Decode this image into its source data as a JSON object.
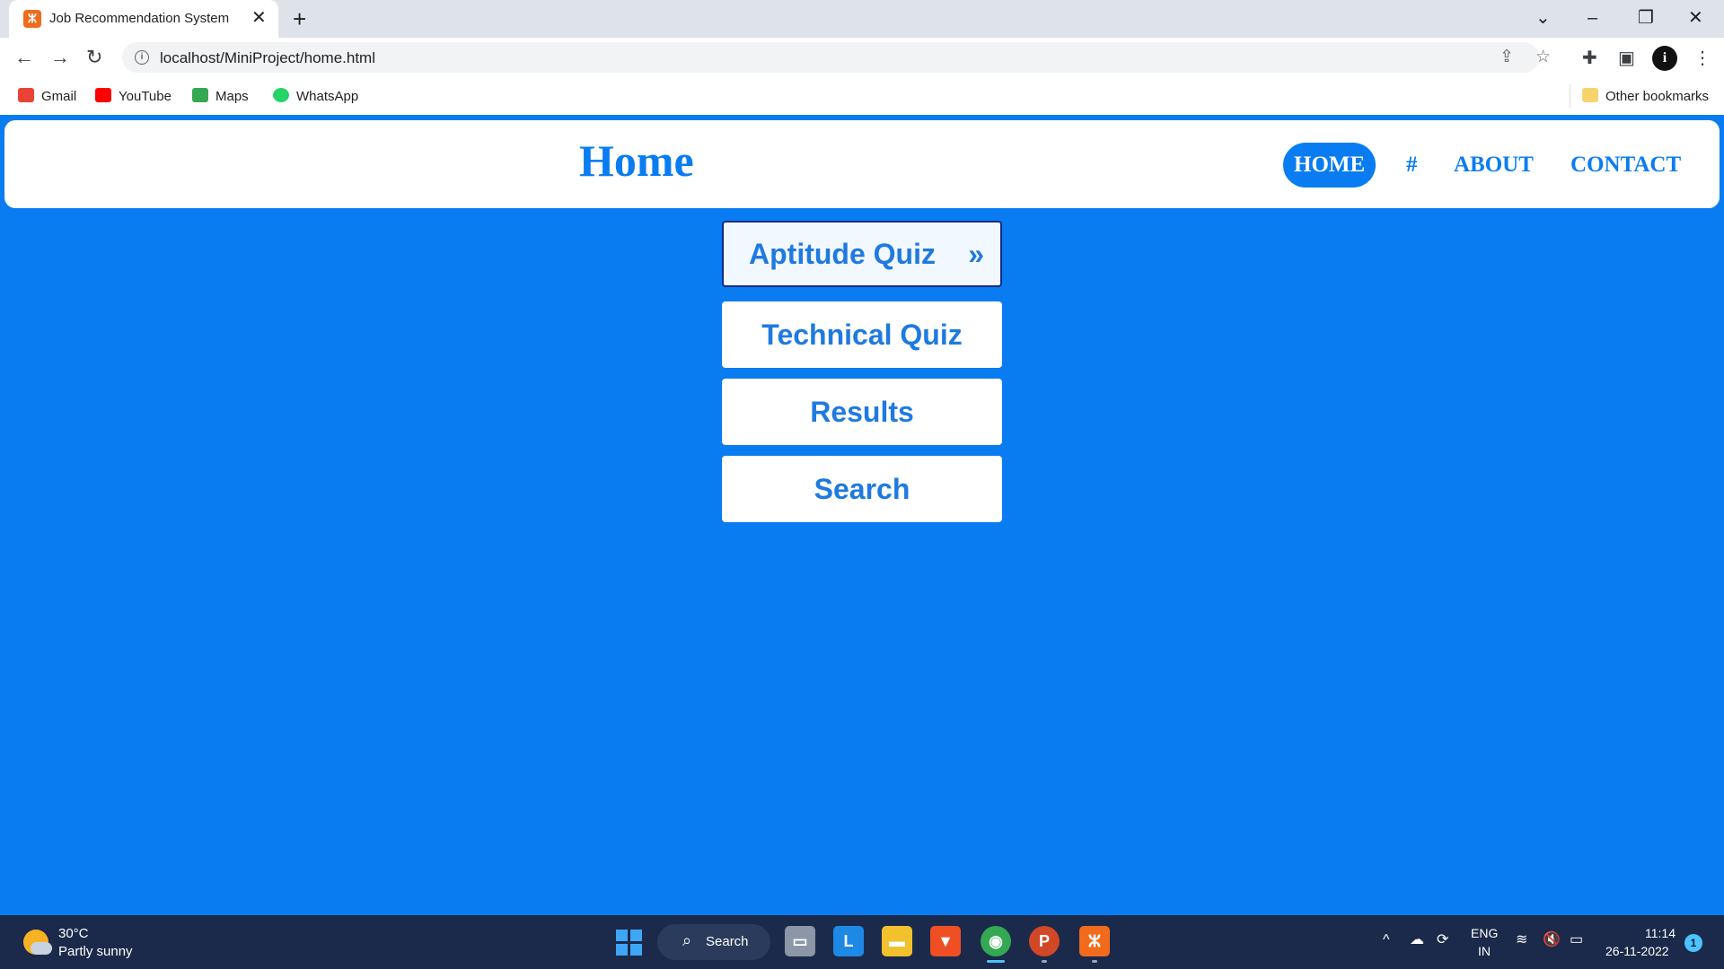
{
  "browser": {
    "tab_title": "Job Recommendation System",
    "tab_favicon": "xampp-icon",
    "url": "localhost/MiniProject/home.html",
    "bookmarks": [
      {
        "label": "Gmail",
        "icon": "gmail-icon",
        "color": "#ea4335"
      },
      {
        "label": "YouTube",
        "icon": "youtube-icon",
        "color": "#ff0000"
      },
      {
        "label": "Maps",
        "icon": "maps-icon",
        "color": "#34a853"
      },
      {
        "label": "WhatsApp",
        "icon": "whatsapp-icon",
        "color": "#25d366"
      }
    ],
    "other_bookmarks": "Other bookmarks"
  },
  "header": {
    "title": "Home",
    "nav": [
      {
        "label": "HOME",
        "active": true
      },
      {
        "label": "#",
        "active": false
      },
      {
        "label": "ABOUT",
        "active": false
      },
      {
        "label": "CONTACT",
        "active": false
      }
    ]
  },
  "menu": [
    {
      "label": "Aptitude Quiz",
      "arrow": "»",
      "active": true
    },
    {
      "label": "Technical Quiz",
      "active": false
    },
    {
      "label": "Results",
      "active": false
    },
    {
      "label": "Search",
      "active": false
    }
  ],
  "taskbar": {
    "weather_temp": "30°C",
    "weather_desc": "Partly sunny",
    "search_label": "Search",
    "lang_line1": "ENG",
    "lang_line2": "IN",
    "time": "11:14",
    "date": "26-11-2022",
    "notification_count": "1"
  },
  "colors": {
    "page_background": "#0a7cf2",
    "accent": "#0a7cf2",
    "button_text": "#1f7ae0"
  }
}
